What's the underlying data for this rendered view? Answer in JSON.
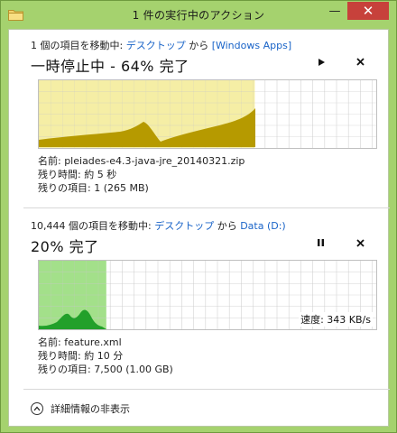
{
  "window": {
    "title": "1 件の実行中のアクション",
    "minimize_glyph": "—",
    "close_glyph": "✕",
    "app_icon": "folder-icon"
  },
  "op1": {
    "header_prefix": "1 個の項目を移動中: ",
    "source": "デスクトップ",
    "header_mid": " から ",
    "destination": "[Windows Apps]",
    "status": "一時停止中 - 64% 完了",
    "progress_percent": 64,
    "resume_icon": "play-icon",
    "cancel_icon": "close-icon",
    "name_line": "名前: pleiades-e4.3-java-jre_20140321.zip",
    "time_line": "残り時間: 約 5 秒",
    "items_line": "残りの項目: 1 (265 MB)",
    "colors": {
      "fill": "#f5eea5",
      "speed": "#b69a00"
    }
  },
  "op2": {
    "header_prefix": "10,444 個の項目を移動中: ",
    "source": "デスクトップ",
    "header_mid": " から ",
    "destination": "Data (D:)",
    "status": "20% 完了",
    "progress_percent": 20,
    "pause_icon": "pause-icon",
    "cancel_icon": "close-icon",
    "speed_text": "速度: 343 KB/s",
    "name_line": "名前: feature.xml",
    "time_line": "残り時間: 約 10 分",
    "items_line": "残りの項目: 7,500 (1.00 GB)",
    "colors": {
      "fill": "#a3e08a",
      "speed": "#22a02a"
    }
  },
  "footer": {
    "label": "詳細情報の非表示",
    "icon": "chevron-up-icon"
  }
}
